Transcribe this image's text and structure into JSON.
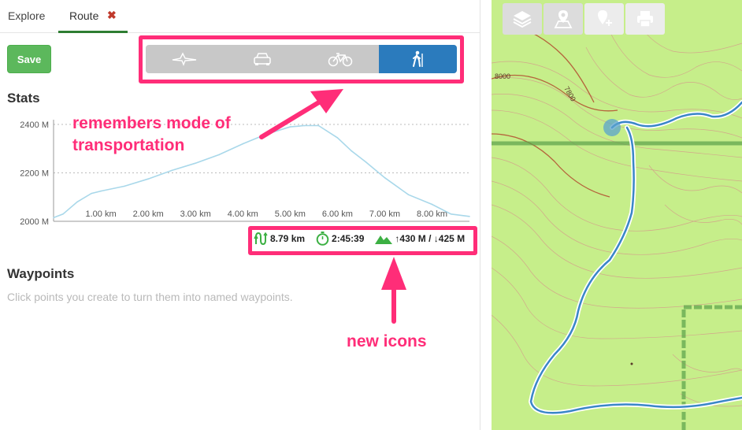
{
  "tabs": {
    "explore": "Explore",
    "route": "Route",
    "close_glyph": "✖"
  },
  "toolbar": {
    "save_label": "Save"
  },
  "modes": [
    {
      "name": "flight",
      "icon": "airplane-icon",
      "active": false
    },
    {
      "name": "car",
      "icon": "car-icon",
      "active": false
    },
    {
      "name": "bike",
      "icon": "bicycle-icon",
      "active": false
    },
    {
      "name": "hike",
      "icon": "hiker-icon",
      "active": true
    }
  ],
  "stats": {
    "heading": "Stats"
  },
  "chart_data": {
    "type": "area",
    "y_ticks": [
      "2400 M",
      "2200 M",
      "2000 M"
    ],
    "x_ticks": [
      "1.00 km",
      "2.00 km",
      "3.00 km",
      "4.00 km",
      "5.00 km",
      "6.00 km",
      "7.00 km",
      "8.00 km"
    ],
    "ylim": [
      2000,
      2400
    ],
    "xlim": [
      0,
      8.79
    ],
    "x": [
      0,
      0.2,
      0.5,
      0.8,
      1.0,
      1.5,
      2.0,
      2.5,
      3.0,
      3.5,
      4.0,
      4.5,
      5.0,
      5.3,
      5.6,
      6.0,
      6.3,
      6.6,
      7.0,
      7.5,
      8.0,
      8.4,
      8.79
    ],
    "y": [
      2015,
      2030,
      2080,
      2115,
      2125,
      2145,
      2175,
      2210,
      2240,
      2275,
      2320,
      2360,
      2390,
      2395,
      2395,
      2345,
      2290,
      2245,
      2180,
      2110,
      2070,
      2030,
      2020
    ],
    "line_color": "#a9d8ea",
    "grid": true
  },
  "summary": {
    "distance": "8.79 km",
    "duration": "2:45:39",
    "elevation": "↑430 M / ↓425 M"
  },
  "waypoints": {
    "heading": "Waypoints",
    "description": "Click points you create to turn them into named waypoints."
  },
  "annotations": {
    "mode_note": "remembers mode of transportation",
    "icons_note": "new icons",
    "color": "#ff2d78"
  },
  "map": {
    "contour_labels": [
      "8000",
      "7800"
    ],
    "background": "#c6ee8a",
    "route_color": "#3a86c8"
  },
  "map_toolbar": [
    {
      "icon": "layers-icon"
    },
    {
      "icon": "map-pin-icon"
    },
    {
      "icon": "add-pin-icon"
    },
    {
      "icon": "print-icon"
    }
  ]
}
